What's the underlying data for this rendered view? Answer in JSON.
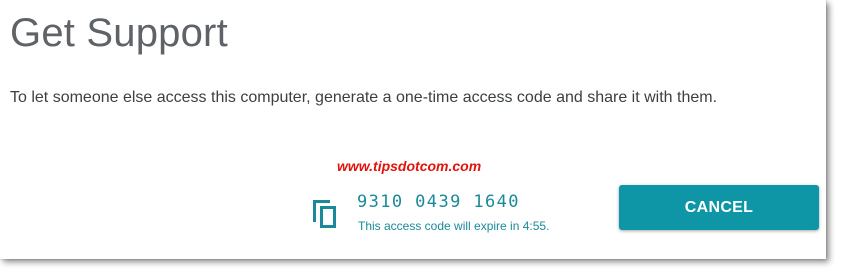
{
  "dialog": {
    "title": "Get Support",
    "description": "To let someone else access this computer, generate a one-time access code and share it with them."
  },
  "watermark": "www.tipsdotcom.com",
  "access": {
    "code": "9310 0439 1640",
    "expiry_text": "This access code will expire in 4:55.",
    "copy_icon": "copy-icon"
  },
  "actions": {
    "cancel_label": "CANCEL"
  },
  "colors": {
    "accent": "#0e95a6",
    "code_text": "#1a8a9a",
    "title_text": "#5f6368",
    "watermark": "#e3120b"
  }
}
